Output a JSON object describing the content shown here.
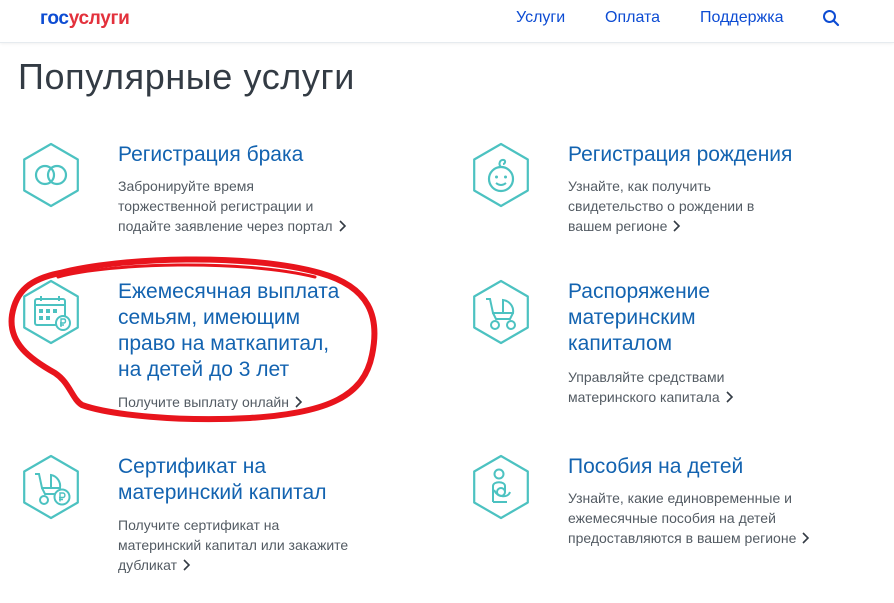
{
  "header": {
    "logo_part1": "гос",
    "logo_part2": "услуги",
    "nav": [
      {
        "label": "Услуги"
      },
      {
        "label": "Оплата"
      },
      {
        "label": "Поддержка"
      }
    ]
  },
  "page_title": "Популярные услуги",
  "services": [
    {
      "title": "Регистрация брака",
      "desc_lines": [
        "Забронируйте время",
        "торжественной регистрации и",
        "подайте заявление через портал"
      ],
      "icon": "wedding-rings-icon"
    },
    {
      "title": "Регистрация рождения",
      "desc_lines": [
        "Узнайте, как получить",
        "свидетельство о рождении в",
        "вашем регионе"
      ],
      "icon": "baby-face-icon"
    },
    {
      "title_lines": [
        "Ежемесячная выплата",
        "семьям, имеющим",
        "право на маткапитал,",
        "на детей до 3 лет"
      ],
      "desc_lines": [
        "Получите выплату онлайн"
      ],
      "icon": "calendar-ruble-icon"
    },
    {
      "title_lines": [
        "Распоряжение",
        "материнским",
        "капиталом"
      ],
      "desc_lines": [
        "Управляйте средствами",
        "материнского капитала"
      ],
      "icon": "stroller-icon"
    },
    {
      "title_lines": [
        "Сертификат на",
        "материнский капитал"
      ],
      "desc_lines": [
        "Получите сертификат на",
        "материнский капитал или закажите",
        "дубликат"
      ],
      "icon": "stroller-ruble-icon"
    },
    {
      "title": "Пособия на детей",
      "desc_lines": [
        "Узнайте, какие единовременные и",
        "ежемесячные пособия на детей",
        "предоставляются в вашем регионе"
      ],
      "icon": "mother-child-icon"
    }
  ],
  "colors": {
    "brand_blue": "#0d4cd3",
    "brand_red": "#e3313c",
    "link_blue": "#1363b0",
    "icon_teal": "#4cc2c1",
    "annotation_red": "#e8141c"
  }
}
